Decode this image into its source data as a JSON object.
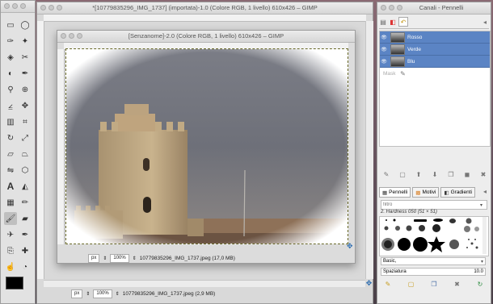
{
  "toolbox": {
    "tools": [
      [
        "rect-select-icon",
        "ellipse-select-icon"
      ],
      [
        "free-select-icon",
        "fuzzy-select-icon"
      ],
      [
        "color-select-icon",
        "scissors-icon"
      ],
      [
        "foreground-select-icon",
        "paths-icon"
      ],
      [
        "color-picker-icon",
        "zoom-icon"
      ],
      [
        "measure-icon",
        "move-icon"
      ],
      [
        "align-icon",
        "crop-icon"
      ],
      [
        "rotate-icon",
        "scale-icon"
      ],
      [
        "shear-icon",
        "perspective-icon"
      ],
      [
        "flip-icon",
        "cage-icon"
      ],
      [
        "text-icon",
        "bucket-fill-icon"
      ],
      [
        "blend-icon",
        "pencil-icon"
      ],
      [
        "paintbrush-icon",
        "eraser-icon"
      ],
      [
        "airbrush-icon",
        "ink-icon"
      ],
      [
        "clone-icon",
        "heal-icon"
      ],
      [
        "smudge-icon",
        "dodge-burn-icon"
      ]
    ],
    "selected": "paintbrush-icon",
    "fg_color": "#000000",
    "bg_color": "#ffffff"
  },
  "back_window": {
    "title": "*[10779835296_IMG_1737] (importata)-1.0 (Colore RGB, 1 livello) 610x426 – GIMP",
    "unit": "px",
    "zoom": "100%",
    "status": "10779835296_IMG_1737.jpeg (2,9 MB)"
  },
  "front_window": {
    "title": "[Senzanome]-2.0 (Colore RGB, 1 livello) 610x426 – GIMP",
    "unit": "px",
    "zoom": "100%",
    "status": "10779835296_IMG_1737.jpeg (17,0 MB)"
  },
  "channels_panel": {
    "title": "Canali - Pennelli",
    "channels": [
      {
        "name": "Rosso"
      },
      {
        "name": "Verde"
      },
      {
        "name": "Blu"
      }
    ],
    "mask_label": "Mask",
    "tabs": [
      {
        "label": "Pennelli",
        "active": true
      },
      {
        "label": "Motivi",
        "active": false
      },
      {
        "label": "Gradienti",
        "active": false
      }
    ],
    "filter_placeholder": "filtro",
    "brush_name": "2. Hardness 050 (51 × 51)",
    "preset": "Basic,",
    "spacing_label": "Spaziatura",
    "spacing_value": "10.0"
  },
  "colors": {
    "accent": "#5b84c4",
    "window_bg": "#e6e6e6",
    "desktop": "#6f5864"
  }
}
